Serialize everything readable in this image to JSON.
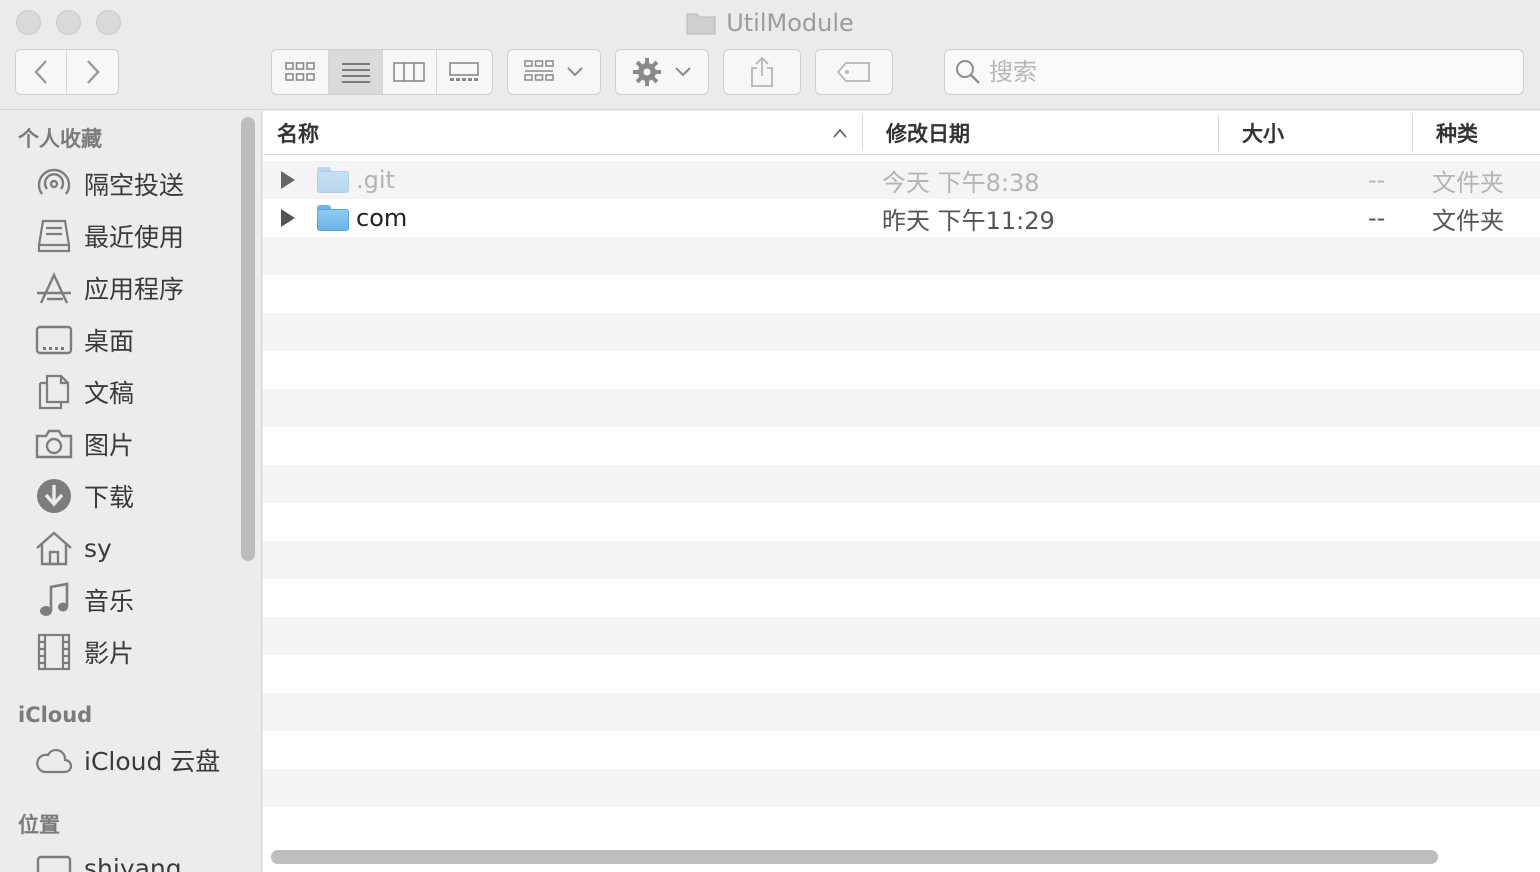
{
  "window": {
    "title": "UtilModule"
  },
  "toolbar": {
    "search_placeholder": "搜索",
    "icons": [
      "chevron-left-icon",
      "chevron-right-icon",
      "icon-view-icon",
      "list-view-icon",
      "column-view-icon",
      "gallery-view-icon",
      "group-icon",
      "gear-icon",
      "share-icon",
      "tag-icon",
      "search-icon"
    ]
  },
  "sidebar": {
    "favorites_header": "个人收藏",
    "favorites": [
      {
        "label": "隔空投送",
        "icon": "airdrop-icon"
      },
      {
        "label": "最近使用",
        "icon": "recents-icon"
      },
      {
        "label": "应用程序",
        "icon": "applications-icon"
      },
      {
        "label": "桌面",
        "icon": "desktop-icon"
      },
      {
        "label": "文稿",
        "icon": "documents-icon"
      },
      {
        "label": "图片",
        "icon": "camera-icon"
      },
      {
        "label": "下载",
        "icon": "download-icon"
      },
      {
        "label": "sy",
        "icon": "home-icon"
      },
      {
        "label": "音乐",
        "icon": "music-icon"
      },
      {
        "label": "影片",
        "icon": "film-icon"
      }
    ],
    "icloud_header": "iCloud",
    "icloud": [
      {
        "label": "iCloud 云盘",
        "icon": "cloud-icon"
      }
    ],
    "locations_header": "位置",
    "locations": [
      {
        "label": "shiyang",
        "icon": "disk-icon"
      }
    ]
  },
  "list": {
    "columns": {
      "name": "名称",
      "date": "修改日期",
      "size": "大小",
      "kind": "种类"
    },
    "rows": [
      {
        "name": ".git",
        "date": "今天 下午8:38",
        "size": "--",
        "kind": "文件夹",
        "dimmed": true
      },
      {
        "name": "com",
        "date": "昨天 下午11:29",
        "size": "--",
        "kind": "文件夹",
        "dimmed": false
      }
    ]
  }
}
